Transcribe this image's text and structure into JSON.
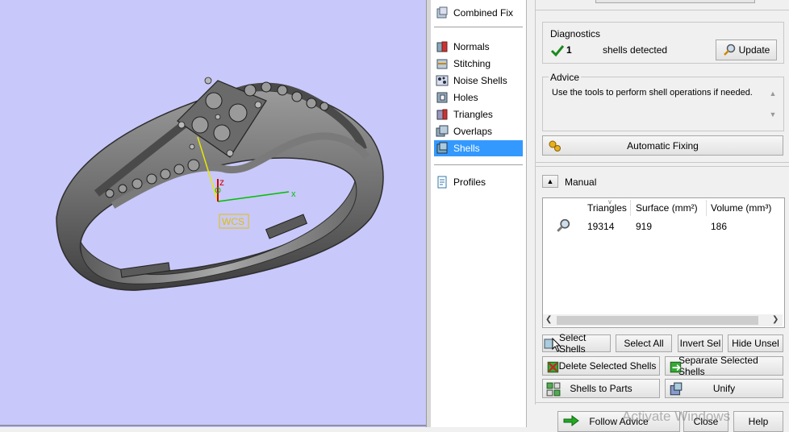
{
  "viewport": {
    "axis_label_z": "z",
    "axis_label_x": "x",
    "wcs_label": "WCS",
    "background": "#c8c8fa"
  },
  "tools": {
    "items": [
      {
        "label": "Combined Fix",
        "icon": "combined-fix-icon"
      },
      {
        "label": "Normals",
        "icon": "normals-icon"
      },
      {
        "label": "Stitching",
        "icon": "stitching-icon"
      },
      {
        "label": "Noise Shells",
        "icon": "noise-shells-icon"
      },
      {
        "label": "Holes",
        "icon": "holes-icon"
      },
      {
        "label": "Triangles",
        "icon": "triangles-icon"
      },
      {
        "label": "Overlaps",
        "icon": "overlaps-icon"
      },
      {
        "label": "Shells",
        "icon": "shells-icon",
        "selected": true
      },
      {
        "label": "Profiles",
        "icon": "profiles-icon"
      }
    ]
  },
  "diagnostics": {
    "title": "Diagnostics",
    "count": "1",
    "text": "shells detected",
    "update_label": "Update"
  },
  "advice": {
    "title": "Advice",
    "text": "Use the tools to perform shell operations if needed."
  },
  "automatic_fixing_label": "Automatic Fixing",
  "manual": {
    "title": "Manual",
    "columns": [
      "Triangles",
      "Surface (mm²)",
      "Volume (mm³)"
    ],
    "rows": [
      {
        "triangles": "19314",
        "surface": "919",
        "volume": "186"
      }
    ]
  },
  "buttons": {
    "select_shells": "Select Shells",
    "select_all": "Select All",
    "invert_sel": "Invert Sel",
    "hide_unsel": "Hide Unsel",
    "delete_selected": "Delete Selected Shells",
    "separate_selected": "Separate Selected Shells",
    "shells_to_parts": "Shells to Parts",
    "unify": "Unify",
    "follow_advice": "Follow Advice",
    "close": "Close",
    "help": "Help"
  },
  "watermark": "Activate Windows",
  "colors": {
    "selection": "#3399ff",
    "check": "#1c8a1c",
    "axis_y": "#e8e800",
    "axis_x": "#00c000",
    "axis_z": "#d00000",
    "wcs": "#e0c000"
  }
}
